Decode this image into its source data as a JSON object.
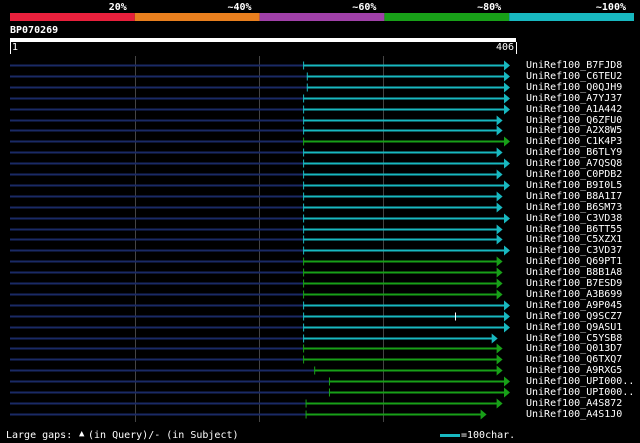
{
  "scale": {
    "labels": [
      "20%",
      "~40%",
      "~60%",
      "~80%",
      "~100%"
    ],
    "colors": [
      "#e8203c",
      "#e87f1e",
      "#a040a8",
      "#18a018",
      "#18b8c0"
    ]
  },
  "query": {
    "id": "BP070269",
    "start_label": "1",
    "end_label": "406",
    "length": 406
  },
  "hits": [
    {
      "name": "UniRef100_B7FJD8",
      "start": 238,
      "end": 406,
      "color": "#18b8c0"
    },
    {
      "name": "UniRef100_C6TEU2",
      "start": 241,
      "end": 406,
      "color": "#18b8c0"
    },
    {
      "name": "UniRef100_Q0QJH9",
      "start": 241,
      "end": 406,
      "color": "#18b8c0"
    },
    {
      "name": "UniRef100_A7YJ37",
      "start": 238,
      "end": 406,
      "color": "#18b8c0"
    },
    {
      "name": "UniRef100_A1A442",
      "start": 238,
      "end": 406,
      "color": "#18b8c0"
    },
    {
      "name": "UniRef100_Q6ZFU0",
      "start": 238,
      "end": 400,
      "color": "#18b8c0"
    },
    {
      "name": "UniRef100_A2X8W5",
      "start": 238,
      "end": 400,
      "color": "#18b8c0"
    },
    {
      "name": "UniRef100_C1K4P3",
      "start": 238,
      "end": 406,
      "color": "#18a018"
    },
    {
      "name": "UniRef100_B6TLY9",
      "start": 238,
      "end": 400,
      "color": "#18b8c0"
    },
    {
      "name": "UniRef100_A7QSQ8",
      "start": 238,
      "end": 406,
      "color": "#18b8c0"
    },
    {
      "name": "UniRef100_C0PDB2",
      "start": 238,
      "end": 400,
      "color": "#18b8c0"
    },
    {
      "name": "UniRef100_B9I0L5",
      "start": 238,
      "end": 406,
      "color": "#18b8c0"
    },
    {
      "name": "UniRef100_B8A1I7",
      "start": 238,
      "end": 400,
      "color": "#18b8c0"
    },
    {
      "name": "UniRef100_B6SM73",
      "start": 238,
      "end": 400,
      "color": "#18b8c0"
    },
    {
      "name": "UniRef100_C3VD38",
      "start": 238,
      "end": 406,
      "color": "#18b8c0"
    },
    {
      "name": "UniRef100_B6TT55",
      "start": 238,
      "end": 400,
      "color": "#18b8c0"
    },
    {
      "name": "UniRef100_C5XZX1",
      "start": 238,
      "end": 400,
      "color": "#18b8c0"
    },
    {
      "name": "UniRef100_C3VD37",
      "start": 238,
      "end": 406,
      "color": "#18b8c0"
    },
    {
      "name": "UniRef100_Q69PT1",
      "start": 238,
      "end": 400,
      "color": "#18a018"
    },
    {
      "name": "UniRef100_B8B1A8",
      "start": 238,
      "end": 400,
      "color": "#18a018"
    },
    {
      "name": "UniRef100_B7ESD9",
      "start": 238,
      "end": 400,
      "color": "#18a018"
    },
    {
      "name": "UniRef100_A3B699",
      "start": 238,
      "end": 400,
      "color": "#18a018"
    },
    {
      "name": "UniRef100_A9P045",
      "start": 238,
      "end": 406,
      "color": "#18b8c0"
    },
    {
      "name": "UniRef100_Q9SCZ7",
      "start": 238,
      "end": 406,
      "color": "#18b8c0"
    },
    {
      "name": "UniRef100_Q9ASU1",
      "start": 238,
      "end": 406,
      "color": "#18b8c0"
    },
    {
      "name": "UniRef100_C5YSB8",
      "start": 238,
      "end": 396,
      "color": "#18b8c0"
    },
    {
      "name": "UniRef100_Q013D7",
      "start": 238,
      "end": 400,
      "color": "#18a018"
    },
    {
      "name": "UniRef100_Q6TXQ7",
      "start": 238,
      "end": 400,
      "color": "#18a018"
    },
    {
      "name": "UniRef100_A9RXG5",
      "start": 247,
      "end": 400,
      "color": "#18a018"
    },
    {
      "name": "UniRef100_UPI000..",
      "start": 259,
      "end": 406,
      "color": "#18a018"
    },
    {
      "name": "UniRef100_UPI000..",
      "start": 259,
      "end": 406,
      "color": "#18a018"
    },
    {
      "name": "UniRef100_A4S872",
      "start": 240,
      "end": 400,
      "color": "#18a018"
    },
    {
      "name": "UniRef100_A4S1J0",
      "start": 240,
      "end": 387,
      "color": "#18a018"
    }
  ],
  "legend": {
    "large_gaps_label": "Large gaps:",
    "query_gap_text": "(in Query)/- (in Subject)",
    "scale_text": "=100char."
  }
}
